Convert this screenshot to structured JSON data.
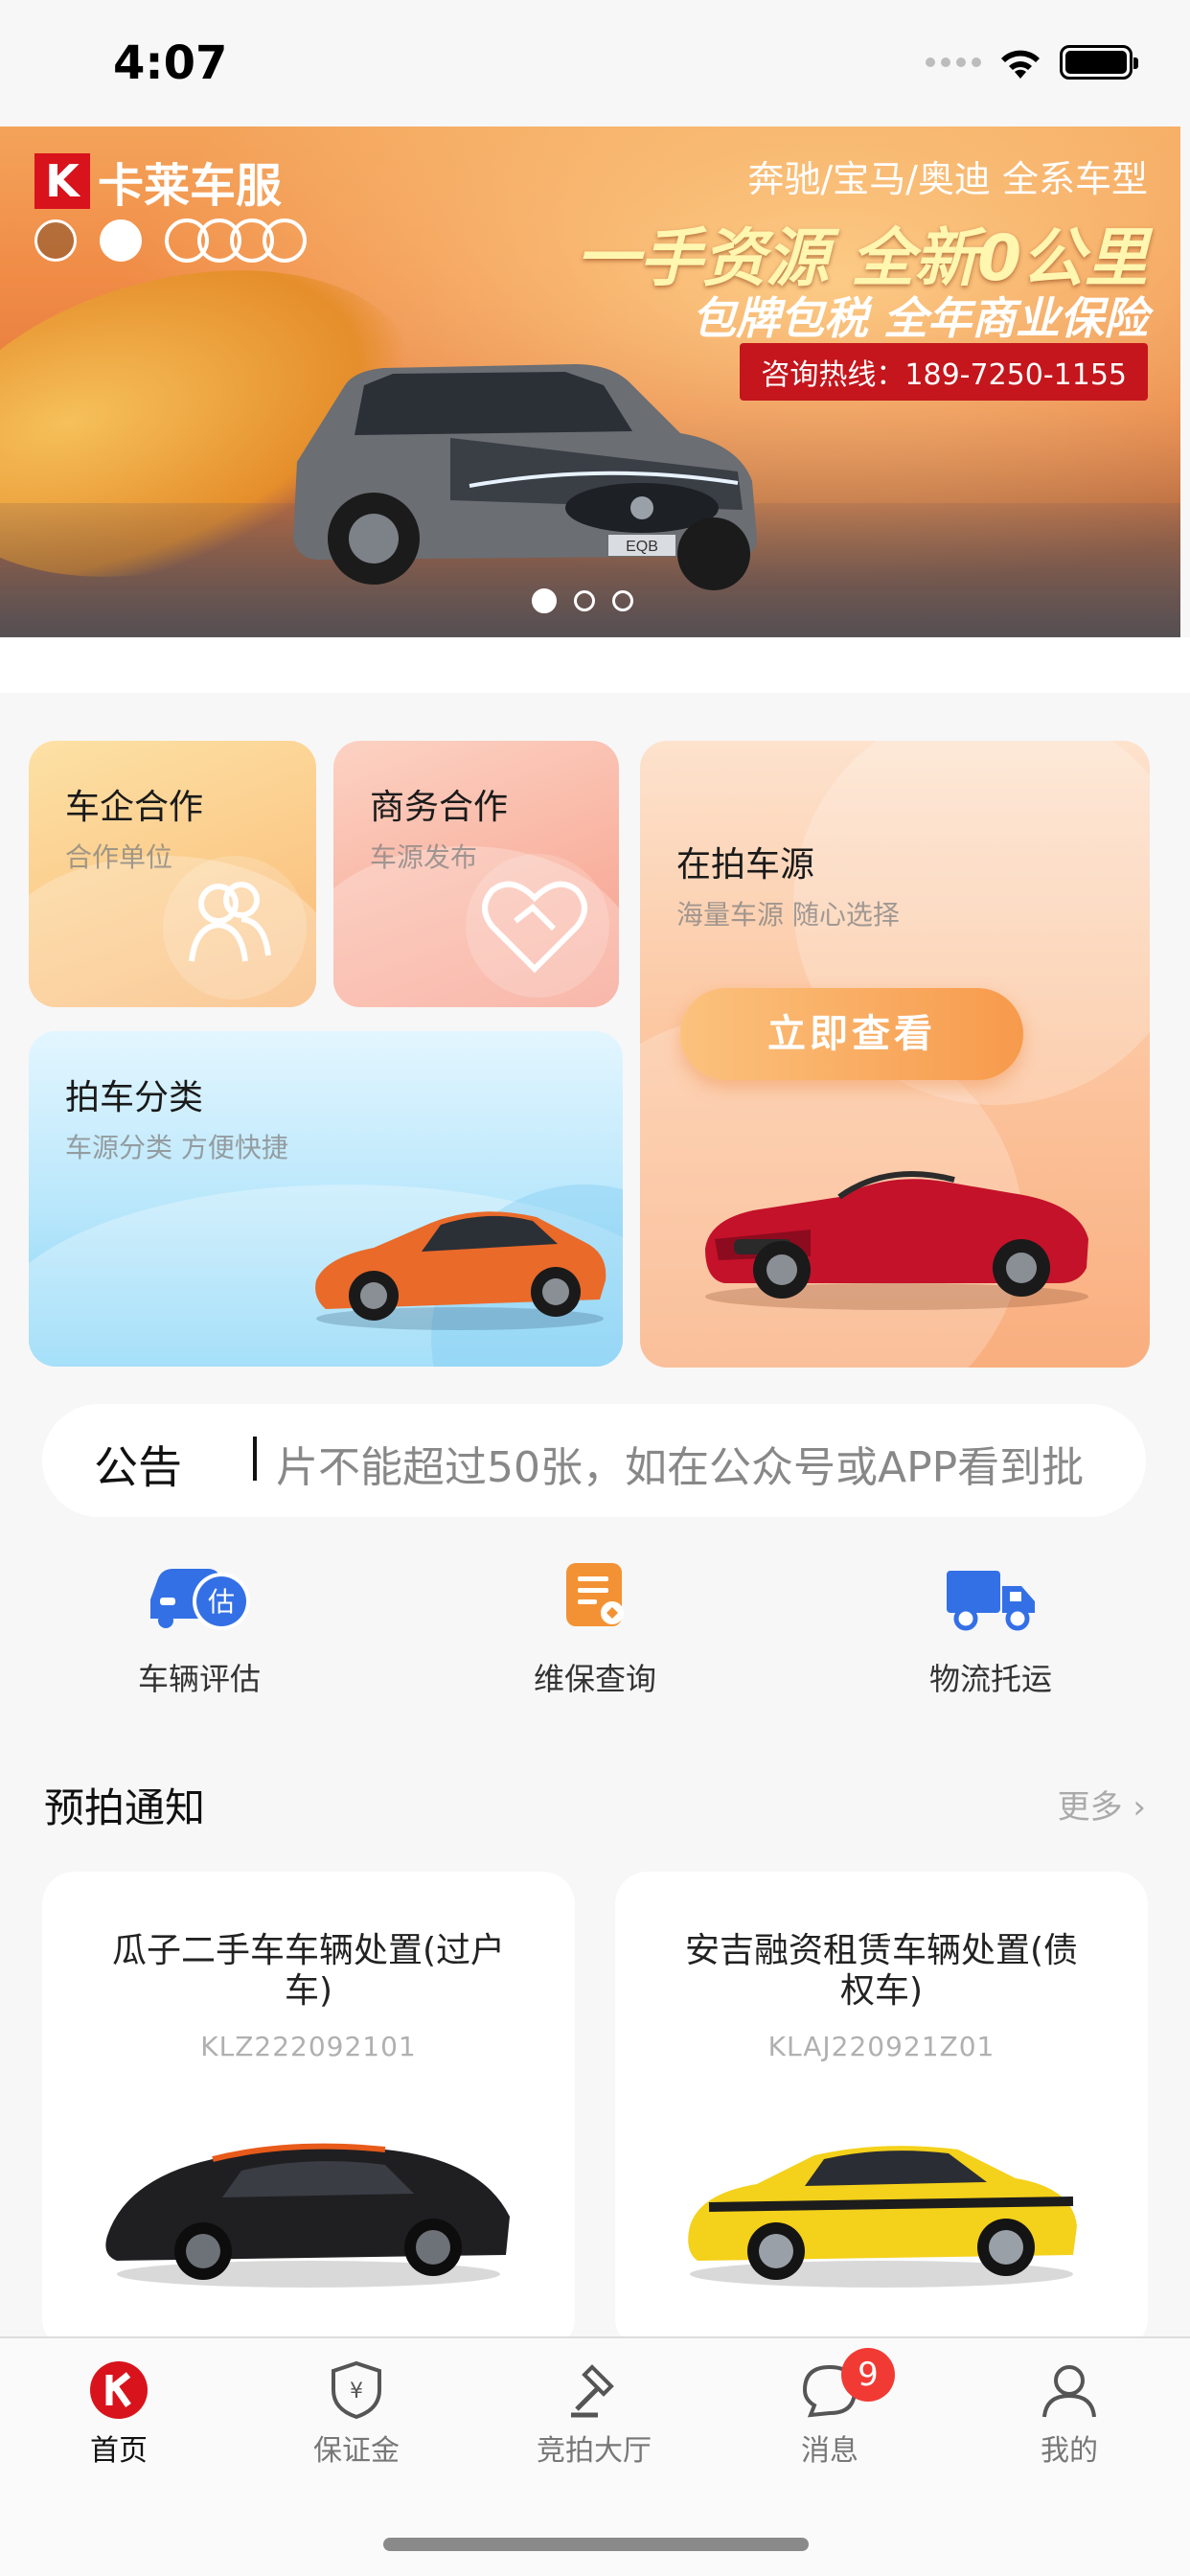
{
  "status_bar": {
    "time": "4:07"
  },
  "banner": {
    "brand": "卡莱车服",
    "brand_k": "K",
    "line1": "奔驰/宝马/奥迪 全系车型",
    "line2": "一手资源 全新0公里",
    "line3": "包牌包税 全年商业保险",
    "hotline": "咨询热线：189-7250-1155",
    "plate": "EQB",
    "slides": 3,
    "active_slide": 1
  },
  "cards": {
    "oem": {
      "title": "车企合作",
      "subtitle": "合作单位"
    },
    "business": {
      "title": "商务合作",
      "subtitle": "车源发布"
    },
    "auction_source": {
      "title": "在拍车源",
      "subtitle": "海量车源 随心选择",
      "button": "立即查看"
    },
    "category": {
      "title": "拍车分类",
      "subtitle": "车源分类 方便快捷"
    }
  },
  "notice": {
    "label": "公告",
    "text": "片不能超过50张，如在公众号或APP看到批"
  },
  "tools": [
    {
      "label": "车辆评估",
      "icon": "car-evaluate-icon"
    },
    {
      "label": "维保查询",
      "icon": "maintenance-query-icon"
    },
    {
      "label": "物流托运",
      "icon": "logistics-truck-icon"
    }
  ],
  "pre_auction": {
    "title": "预拍通知",
    "more": "更多",
    "items": [
      {
        "title": "瓜子二手车车辆处置(过户车)",
        "code": "KLZ222092101"
      },
      {
        "title": "安吉融资租赁车辆处置(债权车)",
        "code": "KLAJ220921Z01"
      }
    ]
  },
  "tabbar": {
    "items": [
      {
        "label": "首页",
        "icon": "home-logo-icon",
        "active": true
      },
      {
        "label": "保证金",
        "icon": "deposit-shield-icon"
      },
      {
        "label": "竞拍大厅",
        "icon": "auction-hammer-icon"
      },
      {
        "label": "消息",
        "icon": "message-icon",
        "badge": "9"
      },
      {
        "label": "我的",
        "icon": "profile-icon"
      }
    ]
  },
  "colors": {
    "brand_red": "#d8131c",
    "badge_red": "#f13a34",
    "tool_blue": "#3370e6",
    "tool_orange": "#f39234"
  }
}
